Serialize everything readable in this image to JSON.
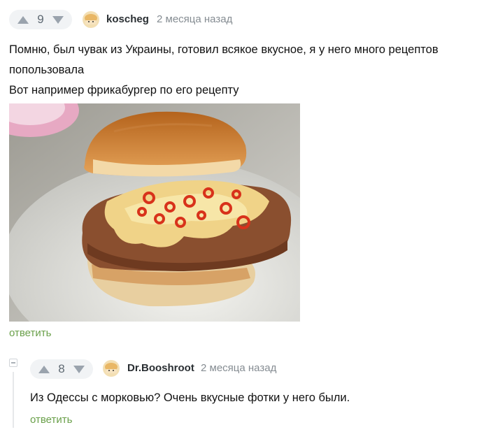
{
  "comment": {
    "rating": "9",
    "username": "koscheg",
    "time": "2 месяца назад",
    "text_line1": "Помню, был чувак из Украины, готовил всякое вкусное, я у него много рецептов",
    "text_line2": "попользовала",
    "text_line3": "Вот например фрикабургер по его рецепту",
    "reply_label": "ответить"
  },
  "reply": {
    "rating": "8",
    "username": "Dr.Booshroot",
    "time": "2 месяца назад",
    "text": "Из Одессы с морковью? Очень вкусные фотки у него были.",
    "reply_label": "ответить"
  },
  "colors": {
    "accent_green": "#6aa04a",
    "vote_bg": "#f1f3f5",
    "vote_arrow": "#9aa3ad"
  },
  "icons": {
    "upvote": "triangle-up-icon",
    "downvote": "triangle-down-icon",
    "avatar": "bun-avatar-icon",
    "collapse": "minus-box-icon"
  }
}
